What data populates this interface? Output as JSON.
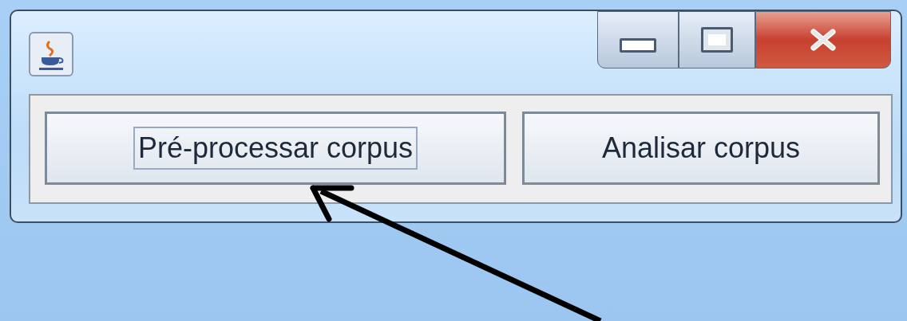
{
  "window": {
    "buttons": [
      {
        "label": "Pré-processar corpus",
        "focused": true
      },
      {
        "label": "Analisar corpus",
        "focused": false
      }
    ]
  }
}
